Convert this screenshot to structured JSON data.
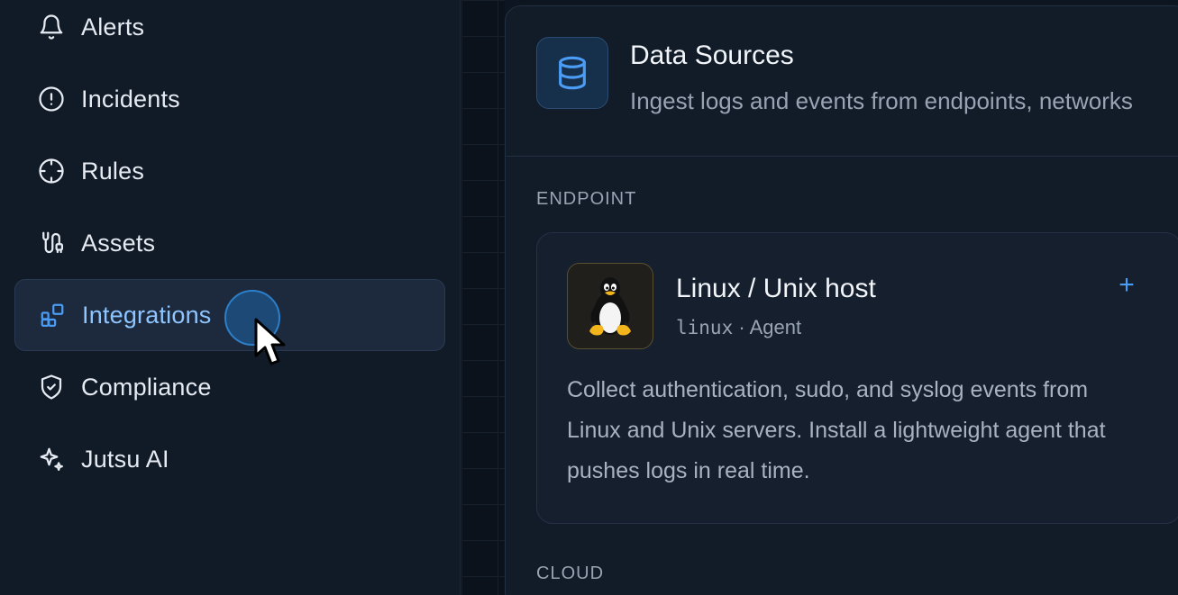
{
  "sidebar": {
    "items": [
      {
        "label": "Alerts",
        "icon": "bell-icon"
      },
      {
        "label": "Incidents",
        "icon": "alert-circle-icon"
      },
      {
        "label": "Rules",
        "icon": "crosshair-icon"
      },
      {
        "label": "Assets",
        "icon": "route-icon"
      },
      {
        "label": "Integrations",
        "icon": "blocks-icon",
        "active": true
      },
      {
        "label": "Compliance",
        "icon": "shield-check-icon"
      },
      {
        "label": "Jutsu AI",
        "icon": "sparkles-icon"
      }
    ]
  },
  "panel": {
    "title": "Data Sources",
    "subtitle": "Ingest logs and events from endpoints, networks",
    "icon": "database-icon"
  },
  "sections": {
    "endpoint": "ENDPOINT",
    "cloud": "CLOUD"
  },
  "card": {
    "title": "Linux / Unix host",
    "slug": "linux",
    "separator": "·",
    "type": "Agent",
    "add_label": "+",
    "description": "Collect authentication, sudo, and syslog events from Linux and Unix servers. Install a lightweight agent that pushes logs in real time.",
    "icon": "tux-icon"
  },
  "colors": {
    "accent": "#4b9cf5",
    "active_label": "#8ec5ff",
    "background": "#0d1521"
  }
}
